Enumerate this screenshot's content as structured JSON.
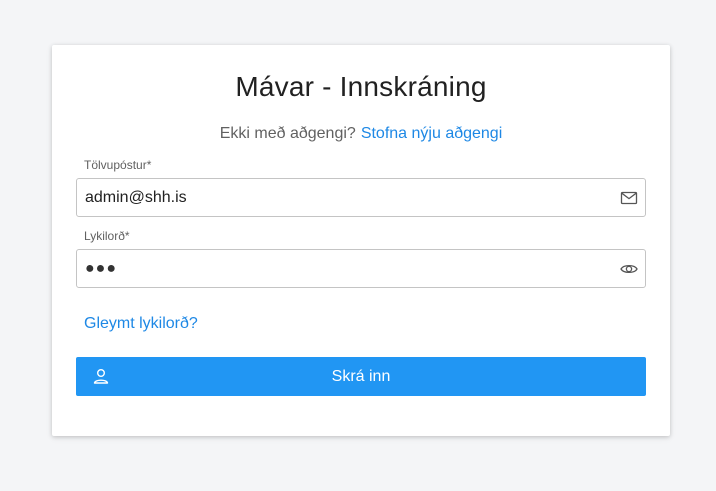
{
  "page": {
    "background": "#f4f5f7",
    "accent": "#2196f3",
    "link_color": "#1e88e5"
  },
  "login": {
    "title": "Mávar - Innskráning",
    "no_account_text": "Ekki með aðgengi?",
    "signup_link": "Stofna nýju aðgengi",
    "email_label": "Tölvupóstur*",
    "email_value": "admin@shh.is",
    "email_icon": "mail-icon",
    "password_label": "Lykilorð*",
    "password_display": "●●●",
    "password_icon": "eye-icon",
    "forgot_link": "Gleymt lykilorð?",
    "submit_label": "Skrá inn",
    "submit_icon": "user-icon"
  }
}
